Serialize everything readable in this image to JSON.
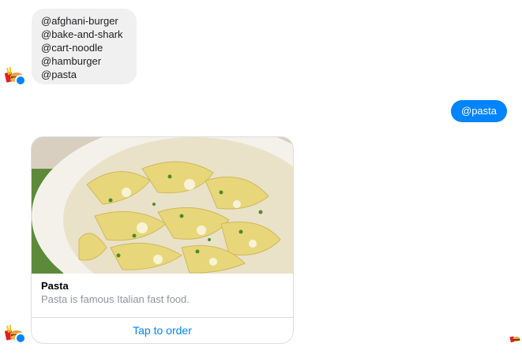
{
  "messages": {
    "incoming_lines": [
      "@afghani-burger",
      "@bake-and-shark",
      "@cart-noodle",
      "@hamburger",
      "@pasta"
    ],
    "outgoing_text": "@pasta"
  },
  "card": {
    "image_icon": "pasta-dish-photo",
    "title": "Pasta",
    "subtitle": "Pasta is famous Italian fast food.",
    "button_label": "Tap to order"
  },
  "icons": {
    "avatar": "bot-avatar-icon",
    "verified_badge": "messenger-badge-icon",
    "read_receipt": "seen-avatar-icon"
  },
  "colors": {
    "accent": "#0084ff",
    "incoming_bubble": "#f1f0f0",
    "subtitle_text": "#90949c"
  }
}
